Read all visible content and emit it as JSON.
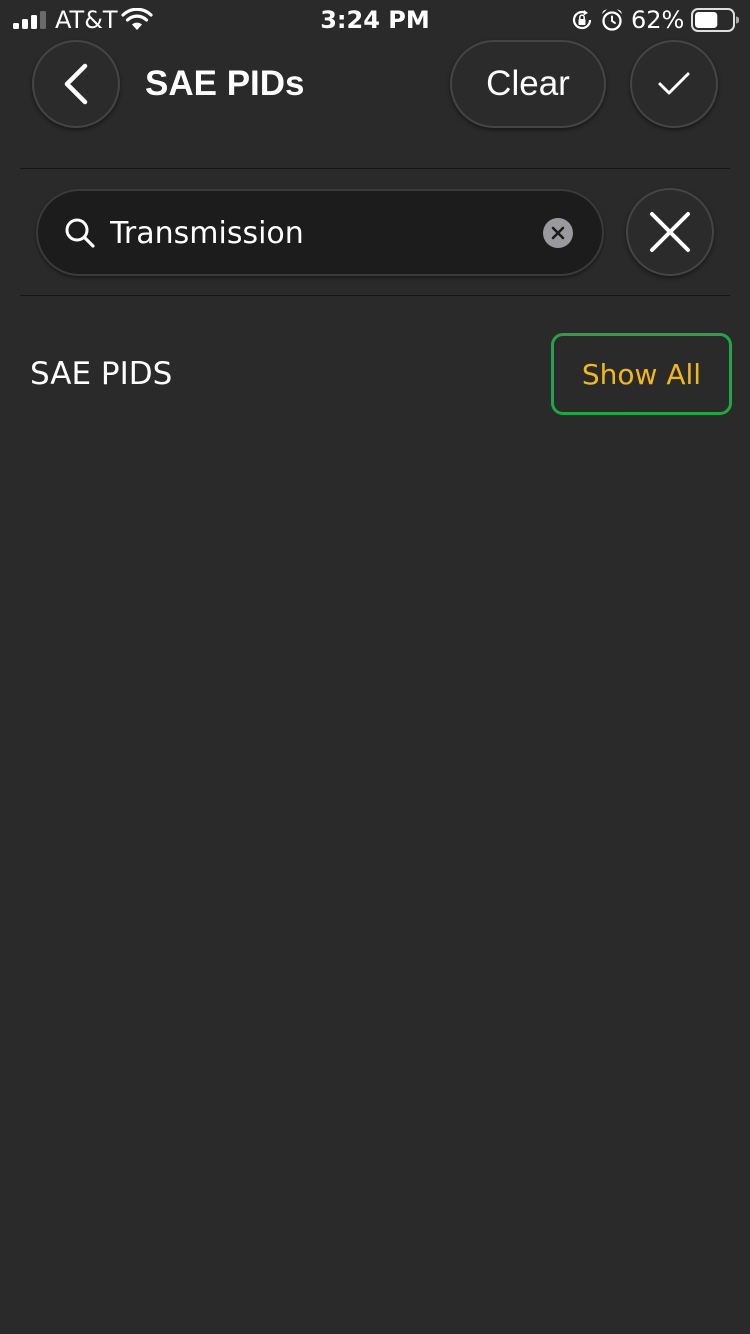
{
  "status_bar": {
    "carrier": "AT&T",
    "time": "3:24 PM",
    "battery_percent": "62%",
    "battery_level": 0.62,
    "icons": [
      "signal-bars-icon",
      "wifi-icon",
      "rotation-lock-icon",
      "alarm-icon",
      "battery-icon"
    ]
  },
  "header": {
    "title": "SAE PIDs",
    "clear_label": "Clear",
    "back_icon": "chevron-left-icon",
    "confirm_icon": "checkmark-icon"
  },
  "search": {
    "value": "Transmission",
    "search_icon": "search-icon",
    "clear_icon": "clear-circle-icon",
    "cancel_icon": "close-icon"
  },
  "section": {
    "label": "SAE PIDS",
    "show_all_label": "Show All"
  },
  "colors": {
    "background": "#2a2a2a",
    "accent_text": "#f2b81a",
    "highlight_border": "#22a54a"
  }
}
